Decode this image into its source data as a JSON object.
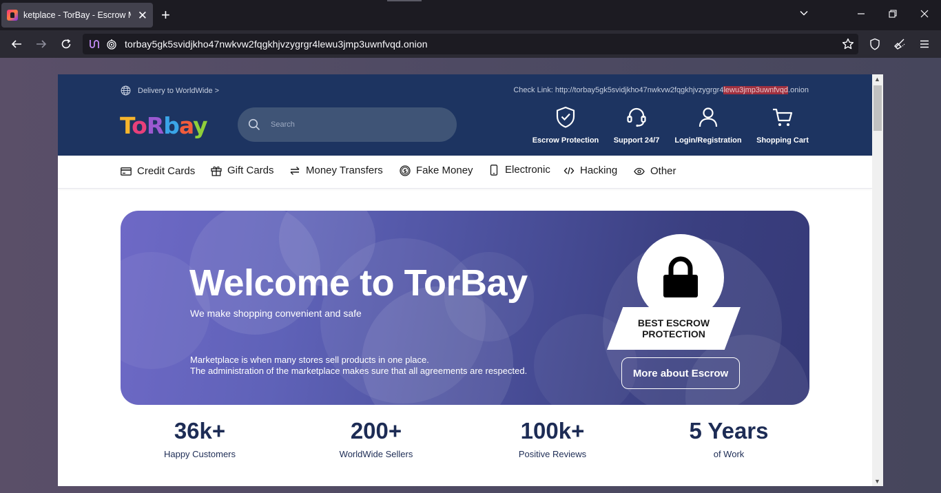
{
  "browser": {
    "tab_title": "ketplace - TorBay - Escrow Marketplace",
    "url": "torbay5gk5svidjkho47nwkvw2fqgkhjvzygrgr4lewu3jmp3uwnfvqd.onion"
  },
  "header": {
    "delivery": "Delivery to WorldWide >",
    "check_link_prefix": "Check Link: http://torbay5gk5svidjkho47nwkvw2fqgkhjvzygrgr4",
    "check_link_highlight": "lewu3jmp3uwnfvqd",
    "check_link_suffix": ".onion",
    "logo_letters": [
      "T",
      "o",
      "R",
      "b",
      "a",
      "y"
    ],
    "logo_colors": [
      "#f7b52c",
      "#e8407a",
      "#9b59d0",
      "#3aa5e8",
      "#f25c3c",
      "#8fcf3a"
    ],
    "search_placeholder": "Search",
    "actions": [
      {
        "label": "Escrow Protection",
        "icon": "shield-check-icon"
      },
      {
        "label": "Support 24/7",
        "icon": "headset-icon"
      },
      {
        "label": "Login/Registration",
        "icon": "user-icon"
      },
      {
        "label": "Shopping Cart",
        "icon": "cart-icon"
      }
    ]
  },
  "categories": [
    {
      "label": "Credit Cards",
      "icon": "credit-card-icon"
    },
    {
      "label": "Gift Cards",
      "icon": "gift-icon"
    },
    {
      "label": "Money Transfers",
      "icon": "transfer-arrows-icon"
    },
    {
      "label": "Fake Money",
      "icon": "dollar-coin-icon"
    },
    {
      "label": "Electronic",
      "icon": "phone-icon"
    },
    {
      "label": "Hacking",
      "icon": "code-icon"
    },
    {
      "label": "Other",
      "icon": "eye-icon"
    }
  ],
  "hero": {
    "title": "Welcome to TorBay",
    "subtitle": "We make shopping convenient and safe",
    "desc_line1": "Marketplace is when many stores sell products in one place.",
    "desc_line2": "The administration of the marketplace makes sure that all agreements are respected.",
    "badge_line1": "BEST ESCROW",
    "badge_line2": "PROTECTION",
    "button": "More about Escrow"
  },
  "stats": [
    {
      "value": "36k+",
      "label": "Happy Customers"
    },
    {
      "value": "200+",
      "label": "WorldWide Sellers"
    },
    {
      "value": "100k+",
      "label": "Positive Reviews"
    },
    {
      "value": "5 Years",
      "label": "of Work"
    }
  ],
  "colors": {
    "header_bg": "#1d3461",
    "accent_highlight": "#a0303f",
    "stat_text": "#1d2c55"
  }
}
